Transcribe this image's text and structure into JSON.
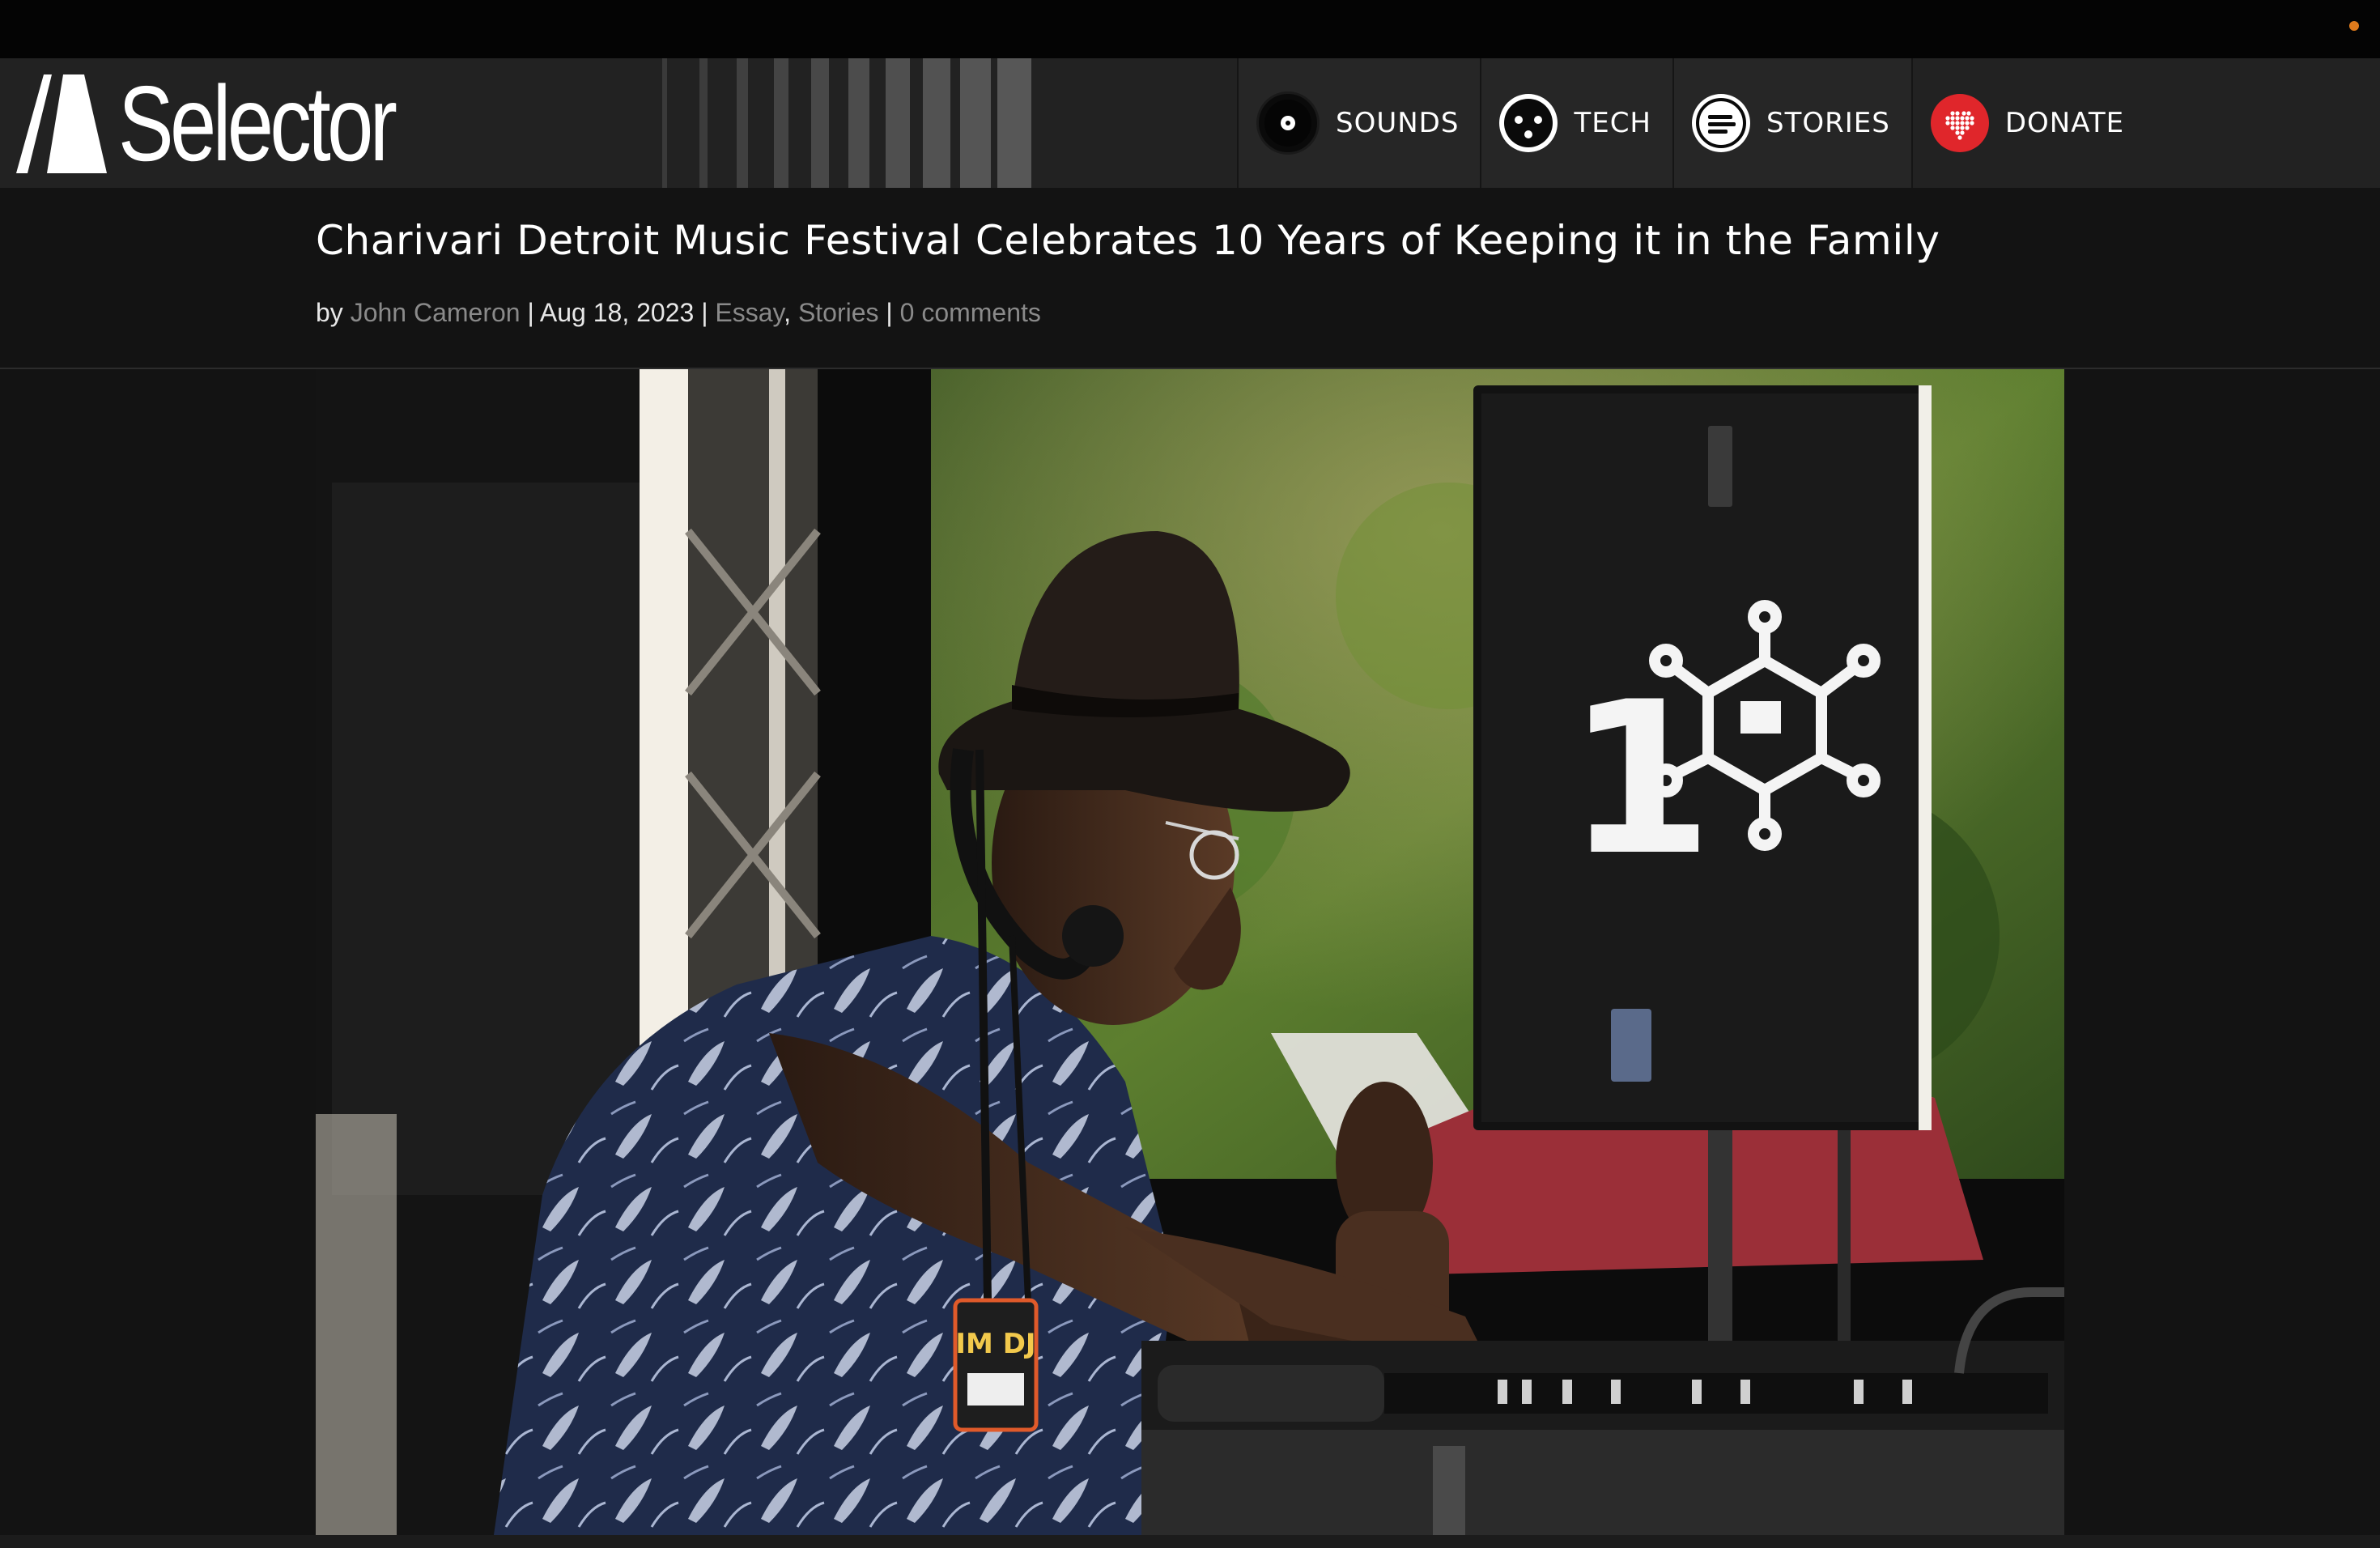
{
  "site": {
    "name": "Selector"
  },
  "nav": {
    "items": [
      {
        "label": "SOUNDS",
        "icon": "record-icon"
      },
      {
        "label": "TECH",
        "icon": "face-icon"
      },
      {
        "label": "STORIES",
        "icon": "text-lines-icon"
      },
      {
        "label": "DONATE",
        "icon": "heart-grid-icon"
      }
    ]
  },
  "article": {
    "title": "Charivari Detroit Music Festival Celebrates 10 Years of Keeping it in the Family",
    "by": "by",
    "author": "John Cameron",
    "sep1": "|",
    "date": "Aug 18, 2023",
    "sep2": "|",
    "category1": "Essay",
    "comma": ",",
    "category2": "Stories",
    "sep3": "|",
    "comments": "0 comments"
  },
  "hero": {
    "speaker_badge_number": "1",
    "lanyard_badge": "IM DJ"
  },
  "colors": {
    "topbar": "#040404",
    "header": "#222222",
    "page": "#131313",
    "donate_red": "#e0262b",
    "meta_link": "#8a8a8a",
    "notification_dot": "#e07b1c"
  }
}
